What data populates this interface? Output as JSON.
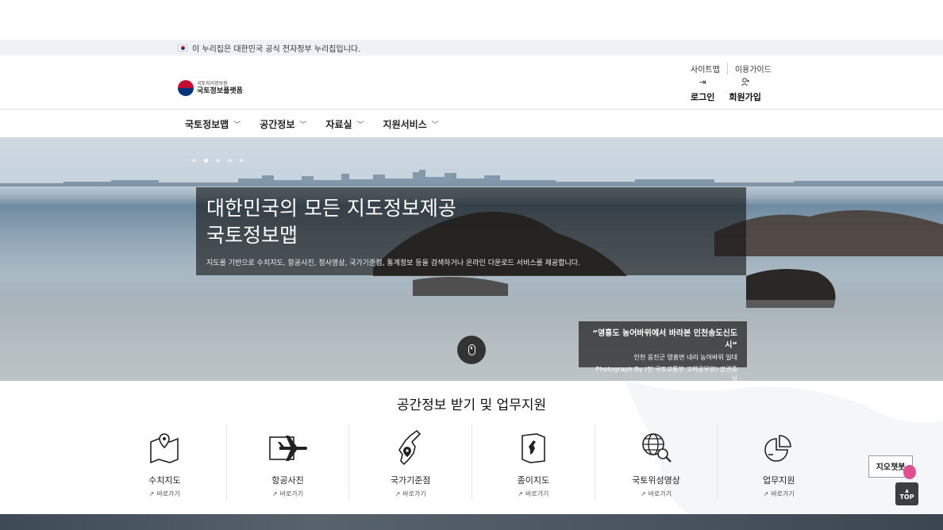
{
  "gov_banner": {
    "text": "이 누리집은 대한민국 공식 전자정부 누리집입니다."
  },
  "logo": {
    "org": "국토지리정보원",
    "name": "국토정보플랫폼"
  },
  "util_links": [
    "사이트맵",
    "이용가이드"
  ],
  "user_actions": {
    "login": "로그인",
    "signup": "회원가입"
  },
  "gnb": [
    "국토정보맵",
    "공간정보",
    "자료실",
    "지원서비스"
  ],
  "hero": {
    "title_line1": "대한민국의 모든 지도정보제공",
    "title_line2": "국토정보맵",
    "description": "지도를 기반으로 수치지도, 항공사진, 정사영상, 국가기준점, 통계정보 등을 검색하거나 온라인 다운로드 서비스를 제공합니다.",
    "slide_count": 5,
    "active_slide": 2,
    "caption_title": "“영흥도 농어바위에서 바라본 인천송도신도시”",
    "caption_location": "인천 옹진군 영흥면 내리 농어바위 일대",
    "caption_credit": "Photograph By (전 국토교통부 고위공무원) 강권중 님"
  },
  "services": {
    "title": "공간정보 받기 및 업무지원",
    "link_label": "바로가기",
    "items": [
      {
        "name": "수치지도",
        "icon": "map-pin-icon"
      },
      {
        "name": "항공사진",
        "icon": "airplane-icon"
      },
      {
        "name": "국가기준점",
        "icon": "korea-map-icon"
      },
      {
        "name": "종이지도",
        "icon": "paper-map-icon"
      },
      {
        "name": "국토위성영상",
        "icon": "globe-search-icon"
      },
      {
        "name": "업무지원",
        "icon": "pie-chart-icon"
      }
    ]
  },
  "chatbot": {
    "label": "지오챗봇"
  },
  "top_button": {
    "label": "TOP"
  },
  "colors": {
    "dark_overlay": "#141414",
    "top_button": "#3b3f44",
    "banner_bg": "#eef1f5"
  }
}
